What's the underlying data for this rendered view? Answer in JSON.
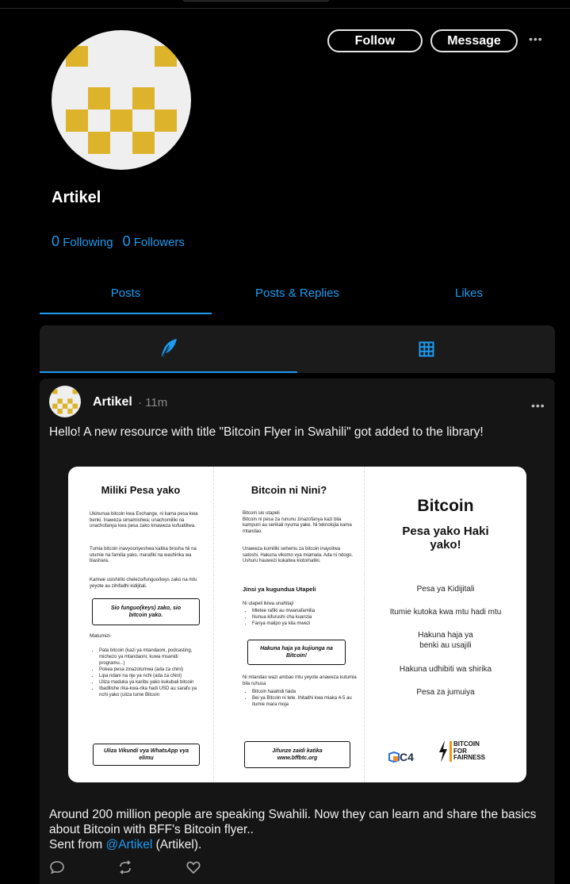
{
  "profile": {
    "name": "Artikel",
    "follow_label": "Follow",
    "message_label": "Message",
    "more_label": "•••",
    "following_count": "0",
    "following_label": "Following",
    "followers_count": "0",
    "followers_label": "Followers"
  },
  "tabs": [
    {
      "label": "Posts",
      "active": true
    },
    {
      "label": "Posts & Replies",
      "active": false
    },
    {
      "label": "Likes",
      "active": false
    }
  ],
  "subtabs": [
    {
      "icon": "feather-icon",
      "active": true
    },
    {
      "icon": "grid-icon",
      "active": false
    }
  ],
  "post": {
    "author": "Artikel",
    "time": "· 11m",
    "more_label": "•••",
    "text": "Hello! A new resource with title \"Bitcoin Flyer in Swahili\" got added to the library!",
    "body": "Around 200 million people are speaking Swahili. Now they can learn and share the basics about Bitcoin with BFF's Bitcoin flyer..",
    "sent_prefix": "Sent from ",
    "mention": "@Artikel",
    "sent_suffix": " (Artikel).",
    "actions": [
      "reply-icon",
      "repost-icon",
      "like-icon"
    ]
  },
  "flyer": {
    "col1": {
      "heading": "Miliki Pesa yako",
      "p1": "Ukinunua bitcoin kwa Exchange, ni kama pesa kwa benki. Inaweza simamishwa; unachomiliki na unachofanya kwa pesa zako kinaweza kufuatiliwa.",
      "p2": "Tumia bitcoin inavyoonyeshwa katika brosha hii na utumie na familia yako, marafiki na washirika wa biashara.",
      "p3": "Kamwe usishiriki chelezo/funguo/keys zako na mtu yeyote au zihifadhi kidijitali.",
      "box": "Sio funguo(keys) zako, sio bitcoin yako.",
      "list_title": "Matumizi",
      "list": [
        "Pata bitcoin (kazi ya mtandaoni, podcasting, michezo ya mtandaoni, kuwa msanidi programu...)",
        "Pokea pesa zinazotumwa (ada za chini)",
        "Lipa ndani na nje ya nchi (ada za chini)",
        "Uliza maduka ya karibu yako kukubali bitcoin",
        "Ibadilishe rika-kwa-rika hadi USD au sarafu ya nchi yako (uliza tume Bitcoin"
      ],
      "footer_box": "Uliza Vikundi vya WhatsApp vya elimu"
    },
    "col2": {
      "heading": "Bitcoin ni Nini?",
      "p1": "Bitcoin sio utapeli\nBitcoin ni pesa za rununu zinazofanya kazi bila kampuni au serikali nyuma yake. Ni teknolojia kama mtandao.",
      "p2": "Unaweza kumiliki sehemu za bitcoin inayoitwa satoshi. Hakuna vikomo vya miamala. Ada ni ndogo. Ushuru hauwezi kukatwa kiotomatiki.",
      "subheading": "Jinsi ya kugundua Utapeli",
      "lead": "Ni utapeli ikiwa unahitaji",
      "list": [
        "Mletee rafiki au mwanafamilia",
        "Nunua kifurushi cha kuanzia",
        "Fanya malipo ya kila mwezi"
      ],
      "box": "Hakuna haja ya kujiunga na Bitcoin!",
      "p3": "Ni mtandao wazi ambao mtu yeyote anaweza kutumia bila ruhusa",
      "list2": [
        "Bitcoin haiahidi faida",
        "Bei ya Bitcoin ni tete. Ihitadhi kwa miaka 4-5 au itumie mara moja"
      ],
      "footer_box": "Jifunze zaidi katika www.bffbtc.org"
    },
    "col3": {
      "title": "Bitcoin",
      "subtitle": "Pesa yako Haki yako!",
      "items": [
        "Pesa ya Kidijitali",
        "Itumie kutoka kwa mtu hadi mtu",
        "Hakuna haja ya benki au usajili",
        "Hakuna udhibiti wa shirika",
        "Pesa za jumuiya"
      ],
      "logo1": "C4",
      "logo2_lines": [
        "BITCOIN",
        "FOR",
        "FAIRNESS"
      ]
    }
  },
  "colors": {
    "accent": "#1d9bf0",
    "gold": "#dcb32a",
    "card_bg": "#151515"
  }
}
